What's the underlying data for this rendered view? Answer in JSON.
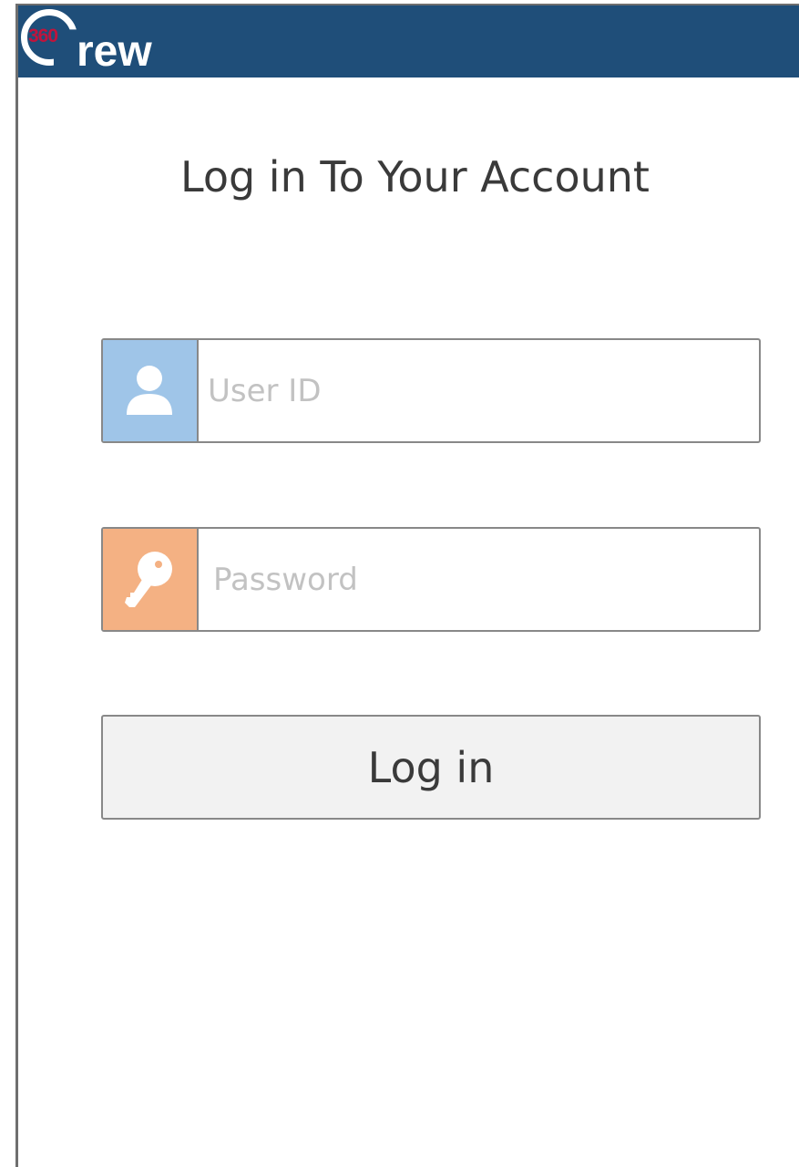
{
  "app": {
    "logo_number": "360",
    "logo_word": "rew",
    "brand_color": "#1f4e79",
    "logo_accent_color": "#c0143c"
  },
  "login": {
    "title": "Log in To Your Account",
    "user_id": {
      "icon": "user-icon",
      "placeholder": "User ID",
      "value": "",
      "icon_background": "#9fc5e8"
    },
    "password": {
      "icon": "key-icon",
      "placeholder": "Password",
      "value": "",
      "icon_background": "#f4b183"
    },
    "submit_label": "Log in"
  }
}
